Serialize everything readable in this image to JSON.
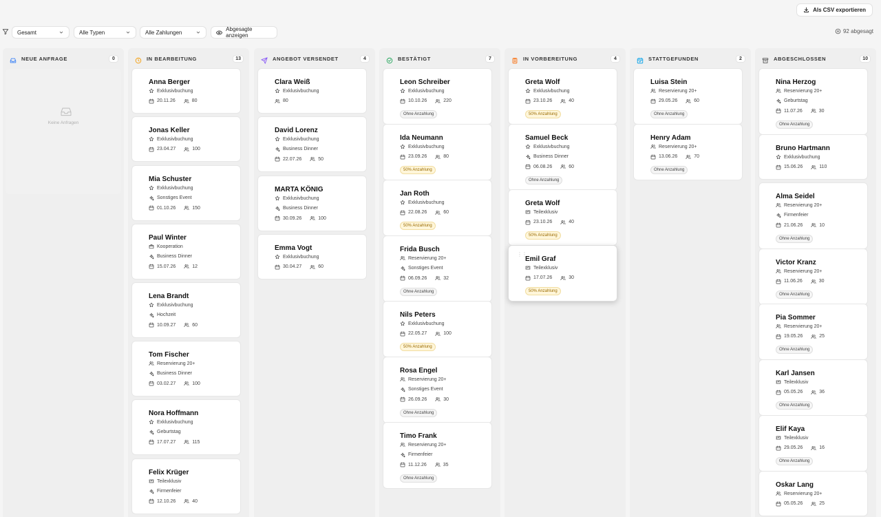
{
  "toolbar": {
    "export_label": "Als CSV exportieren",
    "filter_period": "Gesamt",
    "filter_types": "Alle Typen",
    "filter_payments": "Alle Zahlungen",
    "show_cancelled": "Abgesagte anzeigen",
    "cancelled_count": "92 abgesagt"
  },
  "empty_text": "Keine Anfragen",
  "columns": [
    {
      "title": "NEUE ANFRAGE",
      "count": "0",
      "icon": "inbox-icon",
      "color": "#3b82f6",
      "cards": []
    },
    {
      "title": "IN BEARBEITUNG",
      "count": "13",
      "icon": "clock-icon",
      "color": "#f59e0b",
      "cards": [
        {
          "name": "Anna Berger",
          "lines": [
            {
              "icon": "star-icon",
              "text": "Exklusivbuchung"
            }
          ],
          "date": "20.11.26",
          "guests": "80"
        },
        {
          "name": "Jonas Keller",
          "lines": [
            {
              "icon": "star-icon",
              "text": "Exklusivbuchung"
            }
          ],
          "date": "23.04.27",
          "guests": "100"
        },
        {
          "name": "Mia Schuster",
          "lines": [
            {
              "icon": "star-icon",
              "text": "Exklusivbuchung"
            },
            {
              "icon": "sparkle-icon",
              "text": "Sonstiges Event"
            }
          ],
          "date": "01.10.26",
          "guests": "150"
        },
        {
          "name": "Paul Winter",
          "lines": [
            {
              "icon": "handshake-icon",
              "text": "Kooperation"
            },
            {
              "icon": "sparkle-icon",
              "text": "Business Dinner"
            }
          ],
          "date": "15.07.26",
          "guests": "12"
        },
        {
          "name": "Lena Brandt",
          "lines": [
            {
              "icon": "star-icon",
              "text": "Exklusivbuchung"
            },
            {
              "icon": "sparkle-icon",
              "text": "Hochzeit"
            }
          ],
          "date": "10.09.27",
          "guests": "60"
        },
        {
          "name": "Tom Fischer",
          "lines": [
            {
              "icon": "users-icon",
              "text": "Reservierung 20+"
            },
            {
              "icon": "sparkle-icon",
              "text": "Business Dinner"
            }
          ],
          "date": "03.02.27",
          "guests": "100"
        },
        {
          "name": "Nora Hoffmann",
          "lines": [
            {
              "icon": "star-icon",
              "text": "Exklusivbuchung"
            },
            {
              "icon": "sparkle-icon",
              "text": "Geburtstag"
            }
          ],
          "date": "17.07.27",
          "guests": "115"
        },
        {
          "name": "Felix Krüger",
          "lines": [
            {
              "icon": "ticket-icon",
              "text": "Teilexklusiv"
            },
            {
              "icon": "sparkle-icon",
              "text": "Firmenfeier"
            }
          ],
          "date": "12.10.26",
          "guests": "40"
        }
      ]
    },
    {
      "title": "ANGEBOT VERSENDET",
      "count": "4",
      "icon": "send-icon",
      "color": "#8b5cf6",
      "cards": [
        {
          "name": "Clara Weiß",
          "lines": [
            {
              "icon": "star-icon",
              "text": "Exklusivbuchung"
            }
          ],
          "guests": "80"
        },
        {
          "name": "David Lorenz",
          "lines": [
            {
              "icon": "star-icon",
              "text": "Exklusivbuchung"
            },
            {
              "icon": "sparkle-icon",
              "text": "Business Dinner"
            }
          ],
          "date": "22.07.26",
          "guests": "50"
        },
        {
          "name": "MARTA KÖNIG",
          "lines": [
            {
              "icon": "star-icon",
              "text": "Exklusivbuchung"
            },
            {
              "icon": "sparkle-icon",
              "text": "Business Dinner"
            }
          ],
          "date": "30.09.26",
          "guests": "100"
        },
        {
          "name": "Emma Vogt",
          "lines": [
            {
              "icon": "star-icon",
              "text": "Exklusivbuchung"
            }
          ],
          "date": "30.04.27",
          "guests": "60"
        }
      ]
    },
    {
      "title": "BESTÄTIGT",
      "count": "7",
      "icon": "check-circle-icon",
      "color": "#22a55a",
      "cards": [
        {
          "name": "Leon Schreiber",
          "lines": [
            {
              "icon": "star-icon",
              "text": "Exklusivbuchung"
            }
          ],
          "date": "10.10.26",
          "guests": "220",
          "badge": "Ohne Anzahlung",
          "badge_type": "grey"
        },
        {
          "name": "Ida Neumann",
          "lines": [
            {
              "icon": "star-icon",
              "text": "Exklusivbuchung"
            }
          ],
          "date": "23.09.26",
          "guests": "80",
          "badge": "50% Anzahlung",
          "badge_type": "yellow"
        },
        {
          "name": "Jan Roth",
          "lines": [
            {
              "icon": "star-icon",
              "text": "Exklusivbuchung"
            }
          ],
          "date": "22.08.26",
          "guests": "60",
          "badge": "50% Anzahlung",
          "badge_type": "yellow"
        },
        {
          "name": "Frida Busch",
          "lines": [
            {
              "icon": "users-icon",
              "text": "Reservierung 20+"
            },
            {
              "icon": "sparkle-icon",
              "text": "Sonstiges Event"
            }
          ],
          "date": "06.09.26",
          "guests": "32",
          "badge": "Ohne Anzahlung",
          "badge_type": "grey"
        },
        {
          "name": "Nils Peters",
          "lines": [
            {
              "icon": "star-icon",
              "text": "Exklusivbuchung"
            }
          ],
          "date": "22.05.27",
          "guests": "100",
          "badge": "50% Anzahlung",
          "badge_type": "yellow"
        },
        {
          "name": "Rosa Engel",
          "lines": [
            {
              "icon": "users-icon",
              "text": "Reservierung 20+"
            },
            {
              "icon": "sparkle-icon",
              "text": "Sonstiges Event"
            }
          ],
          "date": "26.09.26",
          "guests": "30",
          "badge": "Ohne Anzahlung",
          "badge_type": "grey"
        },
        {
          "name": "Timo Frank",
          "lines": [
            {
              "icon": "users-icon",
              "text": "Reservierung 20+"
            },
            {
              "icon": "sparkle-icon",
              "text": "Firmenfeier"
            }
          ],
          "date": "11.12.26",
          "guests": "35",
          "badge": "Ohne Anzahlung",
          "badge_type": "grey"
        }
      ]
    },
    {
      "title": "IN VORBEREITUNG",
      "count": "4",
      "icon": "clipboard-icon",
      "color": "#f97316",
      "cards": [
        {
          "name": "Greta Wolf",
          "lines": [
            {
              "icon": "star-icon",
              "text": "Exklusivbuchung"
            }
          ],
          "date": "23.10.26",
          "guests": "40",
          "badge": "50% Anzahlung",
          "badge_type": "yellow"
        },
        {
          "name": "Samuel Beck",
          "lines": [
            {
              "icon": "star-icon",
              "text": "Exklusivbuchung"
            },
            {
              "icon": "sparkle-icon",
              "text": "Business Dinner"
            }
          ],
          "date": "06.08.26",
          "guests": "60",
          "badge": "Ohne Anzahlung",
          "badge_type": "grey"
        },
        {
          "name": "Greta Wolf",
          "lines": [
            {
              "icon": "ticket-icon",
              "text": "Teilexklusiv"
            }
          ],
          "date": "23.10.26",
          "guests": "40",
          "badge": "50% Anzahlung",
          "badge_type": "yellow"
        },
        {
          "name": "Emil Graf",
          "lines": [
            {
              "icon": "ticket-icon",
              "text": "Teilexklusiv"
            }
          ],
          "date": "17.07.26",
          "guests": "30",
          "badge": "50% Anzahlung",
          "badge_type": "yellow"
        }
      ]
    },
    {
      "title": "STATTGEFUNDEN",
      "count": "2",
      "icon": "calendar-check-icon",
      "color": "#0ea5e9",
      "cards": [
        {
          "name": "Luisa Stein",
          "lines": [
            {
              "icon": "users-icon",
              "text": "Reservierung 20+"
            }
          ],
          "date": "29.05.26",
          "guests": "60",
          "badge": "Ohne Anzahlung",
          "badge_type": "grey"
        },
        {
          "name": "Henry Adam",
          "lines": [
            {
              "icon": "users-icon",
              "text": "Reservierung 20+"
            }
          ],
          "date": "13.06.26",
          "guests": "70",
          "badge": "Ohne Anzahlung",
          "badge_type": "grey"
        }
      ]
    },
    {
      "title": "ABGESCHLOSSEN",
      "count": "10",
      "icon": "archive-icon",
      "color": "#555555",
      "cards": [
        {
          "name": "Nina Herzog",
          "lines": [
            {
              "icon": "users-icon",
              "text": "Reservierung 20+"
            },
            {
              "icon": "sparkle-icon",
              "text": "Geburtstag"
            }
          ],
          "date": "11.07.26",
          "guests": "30",
          "badge": "Ohne Anzahlung",
          "badge_type": "grey"
        },
        {
          "name": "Bruno Hartmann",
          "lines": [
            {
              "icon": "star-icon",
              "text": "Exklusivbuchung"
            }
          ],
          "date": "15.06.26",
          "guests": "110"
        },
        {
          "name": "Alma Seidel",
          "lines": [
            {
              "icon": "users-icon",
              "text": "Reservierung 20+"
            },
            {
              "icon": "sparkle-icon",
              "text": "Firmenfeier"
            }
          ],
          "date": "21.06.26",
          "guests": "10",
          "badge": "Ohne Anzahlung",
          "badge_type": "grey"
        },
        {
          "name": "Victor Kranz",
          "lines": [
            {
              "icon": "users-icon",
              "text": "Reservierung 20+"
            }
          ],
          "date": "11.06.26",
          "guests": "30",
          "badge": "Ohne Anzahlung",
          "badge_type": "grey"
        },
        {
          "name": "Pia Sommer",
          "lines": [
            {
              "icon": "users-icon",
              "text": "Reservierung 20+"
            }
          ],
          "date": "19.05.26",
          "guests": "25",
          "badge": "Ohne Anzahlung",
          "badge_type": "grey"
        },
        {
          "name": "Karl Jansen",
          "lines": [
            {
              "icon": "ticket-icon",
              "text": "Teilexklusiv"
            }
          ],
          "date": "05.05.26",
          "guests": "36",
          "badge": "Ohne Anzahlung",
          "badge_type": "grey"
        },
        {
          "name": "Elif Kaya",
          "lines": [
            {
              "icon": "ticket-icon",
              "text": "Teilexklusiv"
            }
          ],
          "date": "29.05.26",
          "guests": "16",
          "badge": "Ohne Anzahlung",
          "badge_type": "grey"
        },
        {
          "name": "Oskar Lang",
          "lines": [
            {
              "icon": "users-icon",
              "text": "Reservierung 20+"
            }
          ],
          "date": "05.05.26",
          "guests": "25"
        }
      ]
    }
  ]
}
